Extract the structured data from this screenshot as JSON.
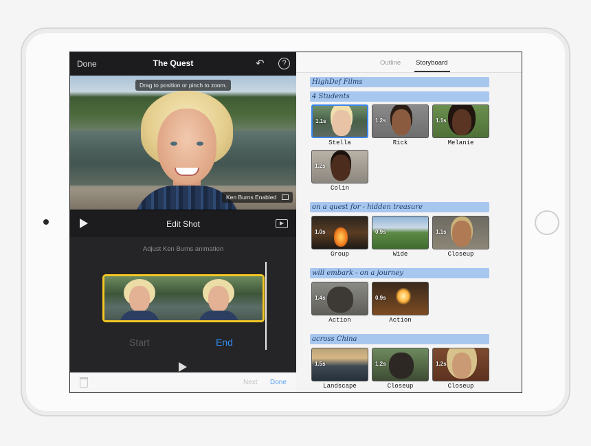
{
  "left": {
    "done_label": "Done",
    "title": "The Quest",
    "undo_icon": "undo-icon",
    "help_label": "?",
    "video_hint": "Drag to position or pinch to zoom.",
    "ken_burns_label": "Ken Burns Enabled",
    "edit_shot_label": "Edit Shot",
    "adjust_label": "Adjust Ken Burns animation",
    "start_label": "Start",
    "end_label": "End",
    "next_label": "Next",
    "footer_done_label": "Done"
  },
  "right": {
    "tabs": [
      {
        "label": "Outline"
      },
      {
        "label": "Storyboard"
      }
    ],
    "selected_tab": "Storyboard",
    "notes": [
      "HighDef Films",
      "4 Students",
      "on a quest for - hidden treasure",
      "will embark - on a journey",
      "across China"
    ],
    "clips": [
      {
        "duration": "1.1s",
        "caption": "Stella"
      },
      {
        "duration": "1.2s",
        "caption": "Rick"
      },
      {
        "duration": "1.1s",
        "caption": "Melanie"
      },
      {
        "duration": "1.2s",
        "caption": "Colin"
      },
      {
        "duration": "1.0s",
        "caption": "Group"
      },
      {
        "duration": "0.9s",
        "caption": "Wide"
      },
      {
        "duration": "1.1s",
        "caption": "Closeup"
      },
      {
        "duration": "1.4s",
        "caption": "Action"
      },
      {
        "duration": "0.9s",
        "caption": "Action"
      },
      {
        "duration": "1.5s",
        "caption": "Landscape"
      },
      {
        "duration": "1.2s",
        "caption": "Closeup"
      },
      {
        "duration": "1.2s",
        "caption": "Closeup"
      }
    ]
  },
  "colors": {
    "accent": "#2f8cf0",
    "strip_border": "#f3c623",
    "note_highlight": "#a8c7ef"
  }
}
